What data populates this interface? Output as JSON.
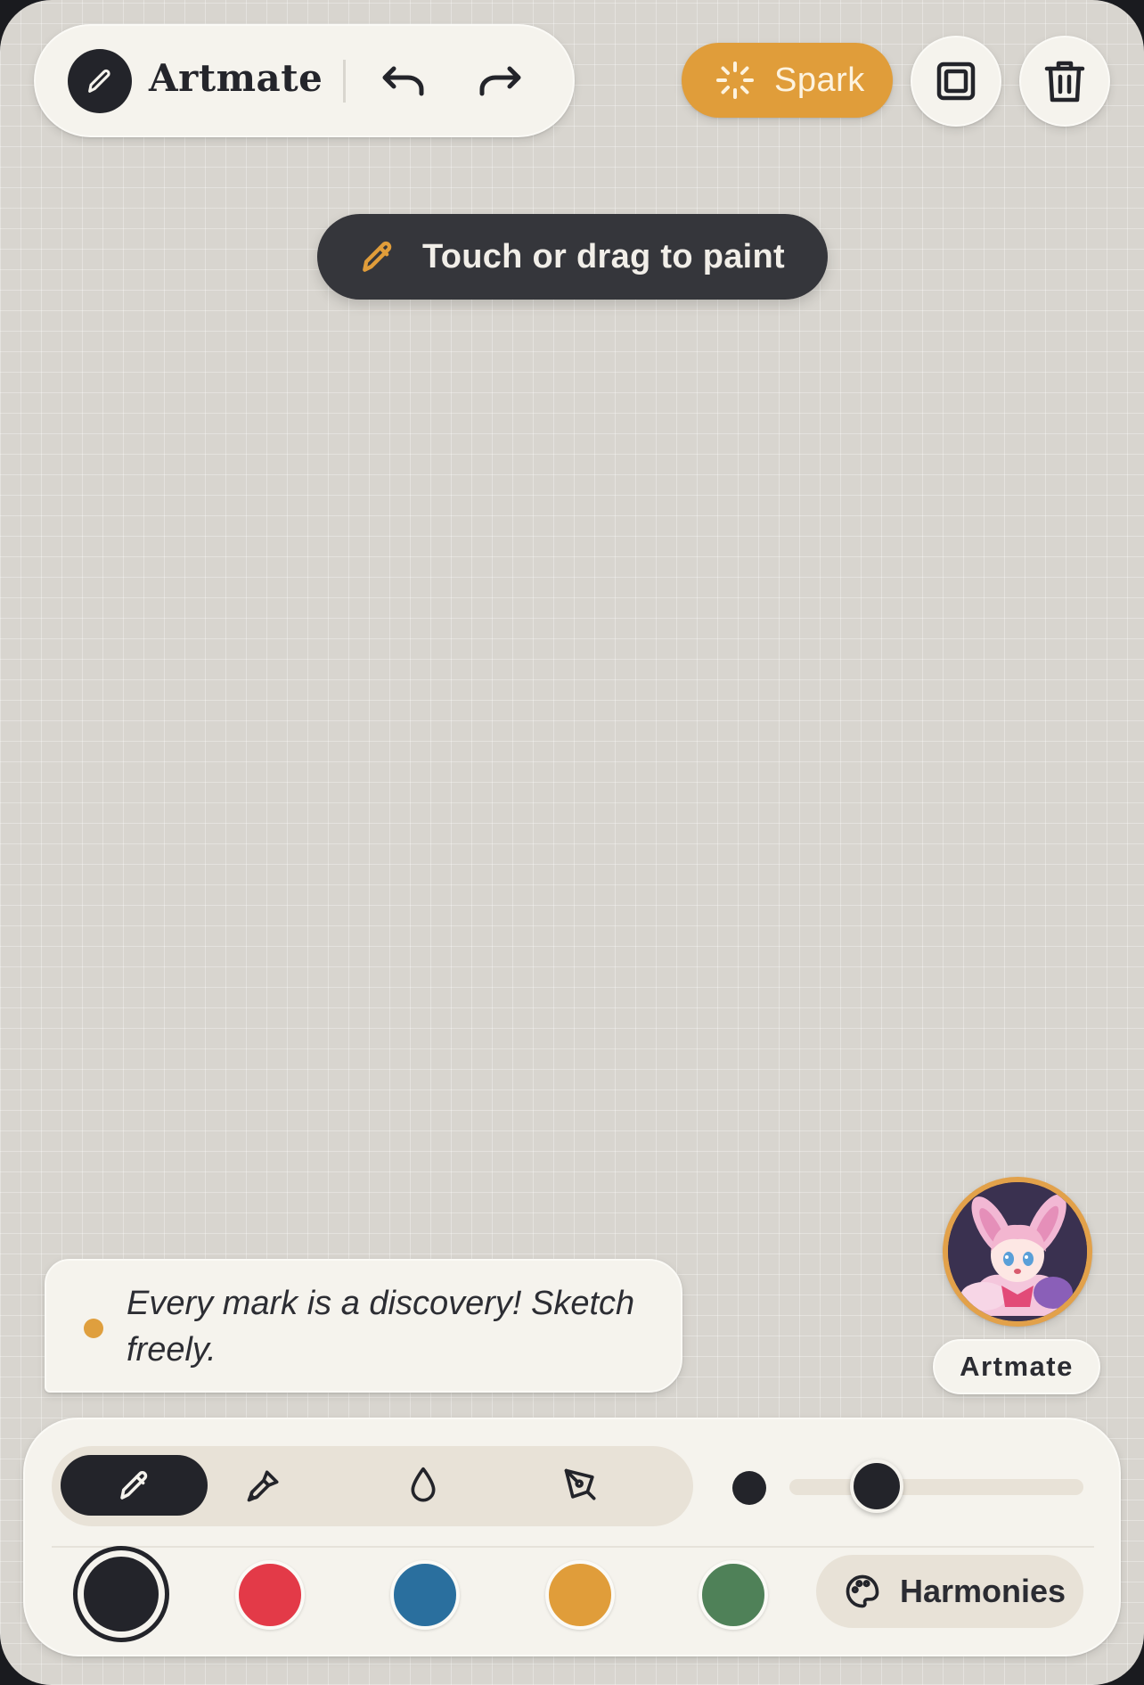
{
  "app": {
    "name": "Artmate"
  },
  "header": {
    "brand_name": "Artmate",
    "undo_icon": "undo-icon",
    "redo_icon": "redo-icon",
    "spark_label": "Spark",
    "frame_icon": "frame-icon",
    "trash_icon": "trash-icon"
  },
  "hint": {
    "text": "Touch or drag to paint",
    "icon": "pencil-icon"
  },
  "companion": {
    "message": "Every mark is a discovery! Sketch freely.",
    "name": "Artmate"
  },
  "toolbar": {
    "tools": [
      {
        "name": "pencil",
        "active": true
      },
      {
        "name": "brush",
        "active": false
      },
      {
        "name": "ink-drop",
        "active": false
      },
      {
        "name": "pen-nib",
        "active": false
      }
    ],
    "brush_size_fraction": 0.25,
    "colors": [
      "#23242a",
      "#e33a48",
      "#2a6f9e",
      "#e09d3a",
      "#4f8158"
    ],
    "selected_color": "#23242a",
    "harmonies_label": "Harmonies"
  },
  "theme": {
    "accent": "#e09d3a",
    "ink": "#23242a",
    "canvas": "#d8d5cf"
  }
}
